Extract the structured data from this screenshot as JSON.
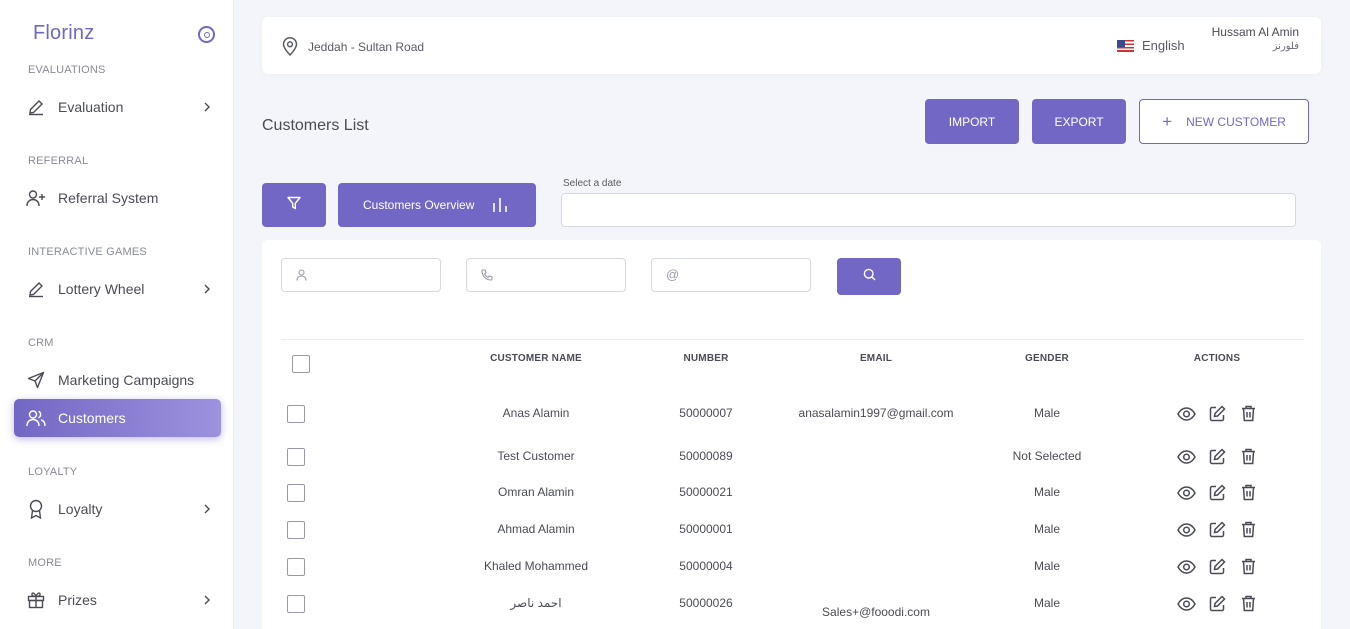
{
  "sidebar": {
    "brand": "Florinz",
    "sections": [
      {
        "title": "EVALUATIONS",
        "item": "Evaluation"
      },
      {
        "title": "REFERRAL",
        "item": "Referral System"
      },
      {
        "title": "INTERACTIVE GAMES",
        "item": "Lottery Wheel"
      },
      {
        "title": "CRM",
        "item": "Marketing Campaigns"
      },
      {
        "title": "",
        "item": "Customers"
      },
      {
        "title": "LOYALTY",
        "item": "Loyalty"
      },
      {
        "title": "MORE",
        "item": "Prizes"
      }
    ]
  },
  "header": {
    "location": "Jeddah - Sultan Road",
    "language": "English",
    "user_name": "Hussam Al Amin",
    "user_sub": "فلورنز"
  },
  "page": {
    "title": "Customers List",
    "import_label": "IMPORT",
    "export_label": "EXPORT",
    "new_customer_label": "NEW CUSTOMER",
    "overview_label": "Customers Overview",
    "date_label": "Select a date"
  },
  "table": {
    "headers": [
      "CUSTOMER NAME",
      "NUMBER",
      "EMAIL",
      "GENDER",
      "ACTIONS"
    ],
    "rows": [
      {
        "name": "Anas Alamin",
        "number": "50000007",
        "email": "anasalamin1997@gmail.com",
        "gender": "Male"
      },
      {
        "name": "Test Customer",
        "number": "50000089",
        "email": "",
        "gender": "Not Selected"
      },
      {
        "name": "Omran Alamin",
        "number": "50000021",
        "email": "",
        "gender": "Male"
      },
      {
        "name": "Ahmad Alamin",
        "number": "50000001",
        "email": "",
        "gender": "Male"
      },
      {
        "name": "Khaled Mohammed",
        "number": "50000004",
        "email": "",
        "gender": "Male"
      },
      {
        "name": "احمد ناصر",
        "number": "50000026",
        "email": "Sales+@fooodi.com",
        "gender": "Male"
      }
    ]
  },
  "colors": {
    "accent": "#7367c5"
  }
}
